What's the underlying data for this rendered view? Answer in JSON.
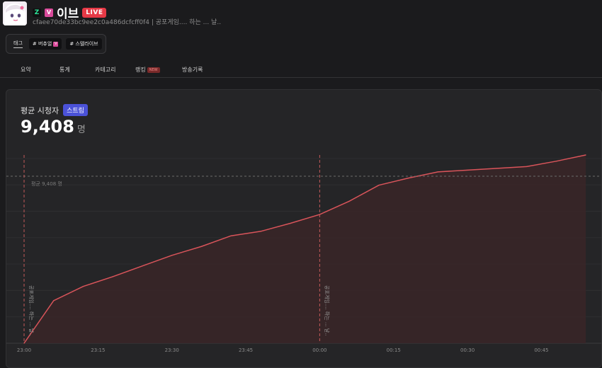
{
  "channel": {
    "name": "이브",
    "v_badge": "V",
    "live": "LIVE",
    "subtitle": "cfaee70de33bc9ee2c0a486dcfcff0f4 | 공포게임.... 하는 ... 날.."
  },
  "tags": {
    "title": "태그",
    "items": [
      {
        "label": "# 버츄얼",
        "has_v": true,
        "v": "V"
      },
      {
        "label": "# 스텔라이브",
        "has_v": false
      }
    ]
  },
  "tabs": [
    {
      "label": "요약"
    },
    {
      "label": "통계"
    },
    {
      "label": "카테고리"
    },
    {
      "label": "랭킹",
      "badge": "NEW"
    },
    {
      "label": "방송기록"
    }
  ],
  "metric": {
    "label": "평균 시청자",
    "badge": "스트림",
    "value": "9,408",
    "unit": "명"
  },
  "colors": {
    "line": "#d9545a",
    "area": "#3a2628",
    "average": "#6a6a6a",
    "marker": "#c45a5a",
    "live_badge": "#e63946",
    "stream_badge": "#4b52d8"
  },
  "chart_data": {
    "type": "area",
    "x": [
      "23:00",
      "23:06",
      "23:12",
      "23:18",
      "23:24",
      "23:30",
      "23:36",
      "23:42",
      "23:48",
      "23:54",
      "00:00",
      "00:06",
      "00:12",
      "00:18",
      "00:24",
      "00:30",
      "00:36",
      "00:42",
      "00:48",
      "00:54"
    ],
    "values": [
      0,
      2400,
      3200,
      3750,
      4350,
      4950,
      5450,
      6050,
      6300,
      6750,
      7250,
      8000,
      8900,
      9300,
      9650,
      9750,
      9850,
      9950,
      10250,
      10600
    ],
    "x_ticks": [
      "23:00",
      "23:15",
      "23:30",
      "23:45",
      "00:00",
      "00:15",
      "00:30",
      "00:45"
    ],
    "ylim": [
      0,
      11000
    ],
    "average": {
      "value": 9408,
      "label": "평균 9,408 명"
    },
    "markers": [
      {
        "x": "23:00",
        "label": "공포게임.... 하는 ... 날.."
      },
      {
        "x": "00:00",
        "label": "공포게임.... 하는 ... 날.."
      }
    ],
    "grid": true
  }
}
